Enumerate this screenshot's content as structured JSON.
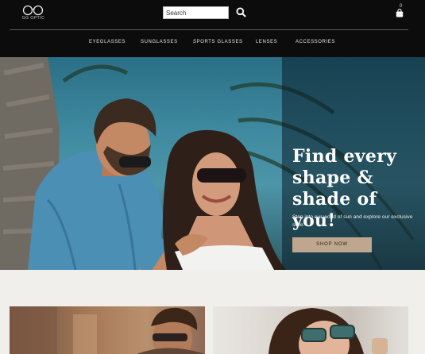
{
  "header": {
    "logo_text": "GG OPTIC",
    "search": {
      "placeholder": "Search",
      "value": ""
    },
    "cart": {
      "count": "0"
    }
  },
  "nav": {
    "items": [
      {
        "label": "EYEGLASSES"
      },
      {
        "label": "SUNGLASSES"
      },
      {
        "label": "SPORTS GLASSES"
      },
      {
        "label": "LENSES"
      },
      {
        "label": "ACCESSORIES"
      }
    ]
  },
  "hero": {
    "title": "Find every shape & shade of you!",
    "subtitle": "Step into our world of sun and explore our exclusive style.",
    "cta_label": "SHOP NOW"
  },
  "colors": {
    "header_bg": "#0c0c0c",
    "cta_bg": "#bfa68e",
    "page_bg": "#f1efec"
  },
  "icons": {
    "logo": "glasses-logo-icon",
    "search": "search-icon",
    "cart": "shopping-bag-icon"
  }
}
